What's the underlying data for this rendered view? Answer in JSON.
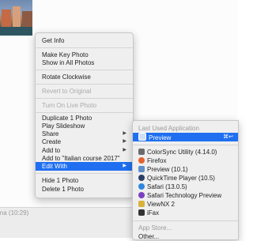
{
  "main_menu": {
    "items": [
      {
        "label": "Get Info"
      },
      {
        "label": "Make Key Photo"
      },
      {
        "label": "Show in All Photos"
      },
      {
        "label": "Rotate Clockwise"
      },
      {
        "label": "Revert to Original"
      },
      {
        "label": "Turn On Live Photo"
      },
      {
        "label": "Duplicate 1 Photo"
      },
      {
        "label": "Play Slideshow"
      },
      {
        "label": "Share"
      },
      {
        "label": "Create"
      },
      {
        "label": "Add to"
      },
      {
        "label": "Add to \"Italian course 2017\""
      },
      {
        "label": "Edit With"
      },
      {
        "label": "Hide 1 Photo"
      },
      {
        "label": "Delete 1 Photo"
      }
    ]
  },
  "submenu": {
    "header": "Last Used Application",
    "selected": {
      "label": "Preview",
      "shortcut": "⌘↩"
    },
    "apps": [
      {
        "label": "ColorSync Utility (4.14.0)",
        "icon": "colorsync-icon",
        "color": "#6b6b6b"
      },
      {
        "label": "Firefox",
        "icon": "firefox-icon",
        "color": "#e8612c"
      },
      {
        "label": "Preview (10.1)",
        "icon": "preview-icon",
        "color": "#5e8fc9"
      },
      {
        "label": "QuickTime Player (10.5)",
        "icon": "quicktime-icon",
        "color": "#2c3e66"
      },
      {
        "label": "Safari (13.0.5)",
        "icon": "safari-icon",
        "color": "#2f86e0"
      },
      {
        "label": "Safari Technology Preview",
        "icon": "safari-tp-icon",
        "color": "#7a3fc2"
      },
      {
        "label": "ViewNX 2",
        "icon": "viewnx-icon",
        "color": "#d8b23a"
      },
      {
        "label": "iFax",
        "icon": "ifax-icon",
        "color": "#333333"
      }
    ],
    "footer": "App Store...",
    "footer2": "Other..."
  },
  "bottom": {
    "partial_text": "ina (10:29)"
  }
}
